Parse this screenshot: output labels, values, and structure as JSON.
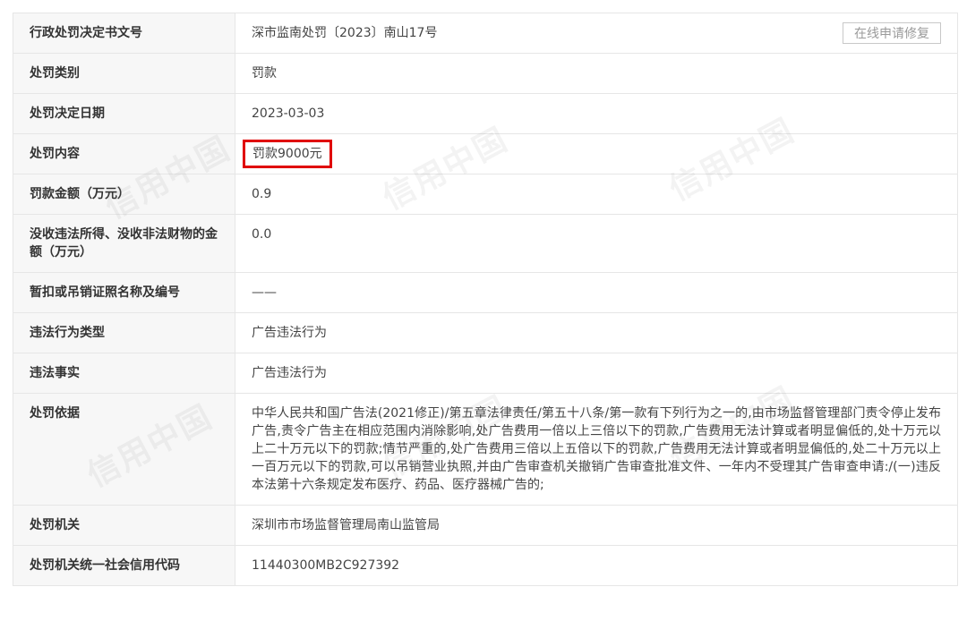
{
  "table": {
    "rows": [
      {
        "label": "行政处罚决定书文号",
        "value": "深市监南处罚〔2023〕南山17号"
      },
      {
        "label": "处罚类别",
        "value": "罚款"
      },
      {
        "label": "处罚决定日期",
        "value": "2023-03-03"
      },
      {
        "label": "处罚内容",
        "value": "罚款9000元"
      },
      {
        "label": "罚款金额（万元）",
        "value": "0.9"
      },
      {
        "label": "没收违法所得、没收非法财物的金额（万元）",
        "value": "0.0"
      },
      {
        "label": "暂扣或吊销证照名称及编号",
        "value": "——"
      },
      {
        "label": "违法行为类型",
        "value": "广告违法行为"
      },
      {
        "label": "违法事实",
        "value": "广告违法行为"
      },
      {
        "label": "处罚依据",
        "value": "中华人民共和国广告法(2021修正)/第五章法律责任/第五十八条/第一款有下列行为之一的,由市场监督管理部门责令停止发布广告,责令广告主在相应范围内消除影响,处广告费用一倍以上三倍以下的罚款,广告费用无法计算或者明显偏低的,处十万元以上二十万元以下的罚款;情节严重的,处广告费用三倍以上五倍以下的罚款,广告费用无法计算或者明显偏低的,处二十万元以上一百万元以下的罚款,可以吊销营业执照,并由广告审查机关撤销广告审查批准文件、一年内不受理其广告审查申请:/(一)违反本法第十六条规定发布医疗、药品、医疗器械广告的;"
      },
      {
        "label": "处罚机关",
        "value": "深圳市市场监督管理局南山监管局"
      },
      {
        "label": "处罚机关统一社会信用代码",
        "value": "11440300MB2C927392"
      }
    ],
    "repair_button": "在线申请修复"
  },
  "watermark": "信用中国",
  "colors": {
    "highlight_border": "#e00000",
    "label_bg": "#f7f7f7",
    "border": "#e6e6e6"
  }
}
